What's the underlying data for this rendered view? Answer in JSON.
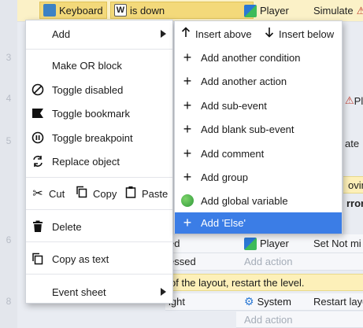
{
  "sheet": {
    "row_numbers": [
      "3",
      "4",
      "5",
      "6",
      "8"
    ],
    "keyboard_label": "Keyboard",
    "w_key": "W",
    "is_down": "is down",
    "player": "Player",
    "simulate": "Simulate",
    "pla_partial": "Pla",
    "ate_partial": "ate",
    "moving_partial": "oving",
    "error_partial": "rror",
    "player2": "Player",
    "set_not": "Set Not mi",
    "ed_partial": "ed",
    "essed_partial": "essed",
    "add_action": "Add action",
    "note_text": "of the layout, restart the level.",
    "ight_partial": "ight",
    "system": "System",
    "restart_layout": "Restart layo",
    "add_action2": "Add action"
  },
  "menu": {
    "add": "Add",
    "make_or": "Make OR block",
    "toggle_disabled": "Toggle disabled",
    "toggle_bookmark": "Toggle bookmark",
    "toggle_breakpoint": "Toggle breakpoint",
    "replace_object": "Replace object",
    "cut": "Cut",
    "copy": "Copy",
    "paste": "Paste",
    "delete": "Delete",
    "copy_as_text": "Copy as text",
    "event_sheet": "Event sheet"
  },
  "submenu": {
    "insert_above": "Insert above",
    "insert_below": "Insert below",
    "add_condition": "Add another condition",
    "add_action": "Add another action",
    "add_sub_event": "Add sub-event",
    "add_blank_sub_event": "Add blank sub-event",
    "add_comment": "Add comment",
    "add_group": "Add group",
    "add_global_variable": "Add global variable",
    "add_else": "Add 'Else'"
  },
  "colors": {
    "selection": "#3b7de6",
    "highlight_row": "#fbf1c7",
    "note": "#fdf0b9"
  }
}
